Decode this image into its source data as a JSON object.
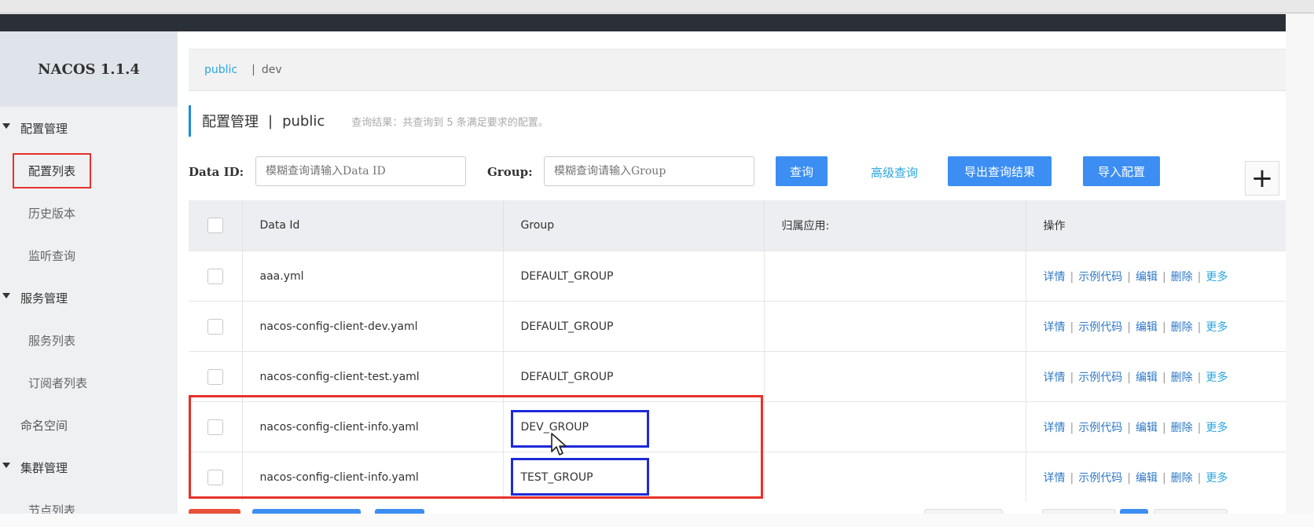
{
  "sidebar": {
    "brand": "NACOS 1.1.4",
    "items": [
      {
        "label": "配置管理",
        "type": "group"
      },
      {
        "label": "配置列表",
        "type": "sub-active"
      },
      {
        "label": "历史版本",
        "type": "sub"
      },
      {
        "label": "监听查询",
        "type": "sub"
      },
      {
        "label": "服务管理",
        "type": "group"
      },
      {
        "label": "服务列表",
        "type": "sub"
      },
      {
        "label": "订阅者列表",
        "type": "sub"
      },
      {
        "label": "命名空间",
        "type": "top"
      },
      {
        "label": "集群管理",
        "type": "group"
      },
      {
        "label": "节点列表",
        "type": "sub"
      }
    ]
  },
  "namespace_bar": {
    "public": "public",
    "separator": "|",
    "dev": "dev"
  },
  "header": {
    "title": "配置管理",
    "separator": "|",
    "namespace": "public",
    "hint": "查询结果：共查询到 5 条满足要求的配置。"
  },
  "search": {
    "data_id_label": "Data ID:",
    "data_id_placeholder": "模糊查询请输入Data ID",
    "group_label": "Group:",
    "group_placeholder": "模糊查询请输入Group",
    "query_button": "查询",
    "advanced_query": "高级查询",
    "export_button": "导出查询结果",
    "import_button": "导入配置",
    "add_button": "+"
  },
  "table": {
    "columns": [
      "Data Id",
      "Group",
      "归属应用:",
      "操作"
    ],
    "rows": [
      {
        "data_id": "aaa.yml",
        "group": "DEFAULT_GROUP",
        "app": ""
      },
      {
        "data_id": "nacos-config-client-dev.yaml",
        "group": "DEFAULT_GROUP",
        "app": ""
      },
      {
        "data_id": "nacos-config-client-test.yaml",
        "group": "DEFAULT_GROUP",
        "app": ""
      },
      {
        "data_id": "nacos-config-client-info.yaml",
        "group": "DEV_GROUP",
        "app": ""
      },
      {
        "data_id": "nacos-config-client-info.yaml",
        "group": "TEST_GROUP",
        "app": ""
      }
    ],
    "actions": {
      "detail": "详情",
      "sample_code": "示例代码",
      "edit": "编辑",
      "delete": "删除",
      "more": "更多",
      "sep": "|"
    }
  },
  "colors": {
    "accent": "#3c8ef3",
    "link": "#2aa6e0",
    "highlight_red": "#e8302a",
    "highlight_blue": "#1f2ad8",
    "topbar": "#2b2f36"
  }
}
